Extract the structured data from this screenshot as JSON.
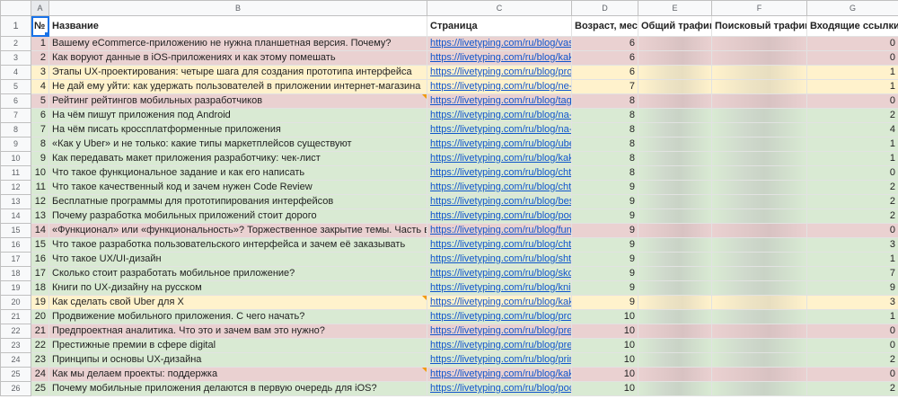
{
  "columns": [
    "",
    "A",
    "B",
    "C",
    "D",
    "E",
    "F",
    "G"
  ],
  "headers": {
    "num": "№",
    "title": "Название",
    "page": "Страница",
    "age": "Возраст, мес.",
    "total": "Общий трафик",
    "search": "Поисковый трафик",
    "links": "Входящие ссылки"
  },
  "colors": {
    "green": "#d9ead3",
    "red": "#ead1d1",
    "yellow": "#fff2cc",
    "link": "#1155cc"
  },
  "rows": [
    {
      "row": "2",
      "n": "1",
      "title": "Вашему eCommerce-приложению не нужна планшетная версия. Почему?",
      "url": "https://livetyping.com/ru/blog/vashe",
      "age": "6",
      "links": "0",
      "c": "red"
    },
    {
      "row": "3",
      "n": "2",
      "title": "Как воруют данные в iOS-приложениях и как этому помешать",
      "url": "https://livetyping.com/ru/blog/kak-vo",
      "age": "6",
      "links": "0",
      "c": "red"
    },
    {
      "row": "4",
      "n": "3",
      "title": "Этапы UX-проектирования: четыре шага для создания прототипа интерфейса",
      "url": "https://livetyping.com/ru/blog/proek",
      "age": "6",
      "links": "1",
      "c": "yellow"
    },
    {
      "row": "5",
      "n": "4",
      "title": "Не дай ему уйти: как удержать пользователей в приложении интернет-магазина",
      "url": "https://livetyping.com/ru/blog/ne-da",
      "age": "7",
      "links": "1",
      "c": "yellow"
    },
    {
      "row": "6",
      "n": "5",
      "title": "Рейтинг рейтингов мобильных разработчиков",
      "url": "https://livetyping.com/ru/blog/taglin",
      "age": "8",
      "links": "0",
      "c": "red",
      "note": true
    },
    {
      "row": "7",
      "n": "6",
      "title": "На чём пишут приложения под Android",
      "url": "https://livetyping.com/ru/blog/na-ch",
      "age": "8",
      "links": "2",
      "c": "green"
    },
    {
      "row": "8",
      "n": "7",
      "title": "На чём писать кроссплатформенные приложения",
      "url": "https://livetyping.com/ru/blog/na-ch",
      "age": "8",
      "links": "4",
      "c": "green"
    },
    {
      "row": "9",
      "n": "8",
      "title": "«Как у Uber» и не только: какие типы маркетплейсов существуют",
      "url": "https://livetyping.com/ru/blog/uber-l",
      "age": "8",
      "links": "1",
      "c": "green"
    },
    {
      "row": "10",
      "n": "9",
      "title": "Как передавать макет приложения разработчику: чек-лист",
      "url": "https://livetyping.com/ru/blog/kak-p",
      "age": "8",
      "links": "1",
      "c": "green"
    },
    {
      "row": "11",
      "n": "10",
      "title": "Что такое функциональное задание и как его написать",
      "url": "https://livetyping.com/ru/blog/chto-t",
      "age": "8",
      "links": "0",
      "c": "green"
    },
    {
      "row": "12",
      "n": "11",
      "title": "Что такое качественный код и зачем нужен Code Review",
      "url": "https://livetyping.com/ru/blog/chto-t",
      "age": "9",
      "links": "2",
      "c": "green"
    },
    {
      "row": "13",
      "n": "12",
      "title": "Бесплатные программы для прототипирования интерфейсов",
      "url": "https://livetyping.com/ru/blog/bespl",
      "age": "9",
      "links": "2",
      "c": "green"
    },
    {
      "row": "14",
      "n": "13",
      "title": "Почему разработка мобильных приложений стоит дорого",
      "url": "https://livetyping.com/ru/blog/poche",
      "age": "9",
      "links": "2",
      "c": "green"
    },
    {
      "row": "15",
      "n": "14",
      "title": "«Функционал» или «функциональность»? Торжественное закрытие темы. Часть вторая",
      "url": "https://livetyping.com/ru/blog/funkci",
      "age": "9",
      "links": "0",
      "c": "red"
    },
    {
      "row": "16",
      "n": "15",
      "title": "Что такое разработка пользовательского интерфейса и зачем её заказывать",
      "url": "https://livetyping.com/ru/blog/chto-t",
      "age": "9",
      "links": "3",
      "c": "green"
    },
    {
      "row": "17",
      "n": "16",
      "title": "Что такое UX/UI-дизайн",
      "url": "https://livetyping.com/ru/blog/shto-t",
      "age": "9",
      "links": "1",
      "c": "green"
    },
    {
      "row": "18",
      "n": "17",
      "title": "Сколько стоит разработать мобильное приложение?",
      "url": "https://livetyping.com/ru/blog/skolk",
      "age": "9",
      "links": "7",
      "c": "green"
    },
    {
      "row": "19",
      "n": "18",
      "title": "Книги по UX-дизайну на русском",
      "url": "https://livetyping.com/ru/blog/knigi-",
      "age": "9",
      "links": "9",
      "c": "green"
    },
    {
      "row": "20",
      "n": "19",
      "title": "Как сделать свой Uber для X",
      "url": "https://livetyping.com/ru/blog/kak-s",
      "age": "9",
      "links": "3",
      "c": "yellow",
      "note": true
    },
    {
      "row": "21",
      "n": "20",
      "title": "Продвижение мобильного приложения. С чего начать?",
      "url": "https://livetyping.com/ru/blog/prodv",
      "age": "10",
      "links": "1",
      "c": "green"
    },
    {
      "row": "22",
      "n": "21",
      "title": "Предпроектная аналитика. Что это и зачем вам это нужно?",
      "url": "https://livetyping.com/ru/blog/predp",
      "age": "10",
      "links": "0",
      "c": "red"
    },
    {
      "row": "23",
      "n": "22",
      "title": "Престижные премии в сфере digital",
      "url": "https://livetyping.com/ru/blog/presti",
      "age": "10",
      "links": "0",
      "c": "green"
    },
    {
      "row": "24",
      "n": "23",
      "title": "Принципы и основы UX-дизайна",
      "url": "https://livetyping.com/ru/blog/printsi",
      "age": "10",
      "links": "2",
      "c": "green"
    },
    {
      "row": "25",
      "n": "24",
      "title": "Как мы делаем проекты: поддержка",
      "url": "https://livetyping.com/ru/blog/kak-m",
      "age": "10",
      "links": "0",
      "c": "red",
      "note": true
    },
    {
      "row": "26",
      "n": "25",
      "title": "Почему мобильные приложения делаются в первую очередь для iOS?",
      "url": "https://livetyping.com/ru/blog/poche",
      "age": "10",
      "links": "2",
      "c": "green"
    }
  ]
}
